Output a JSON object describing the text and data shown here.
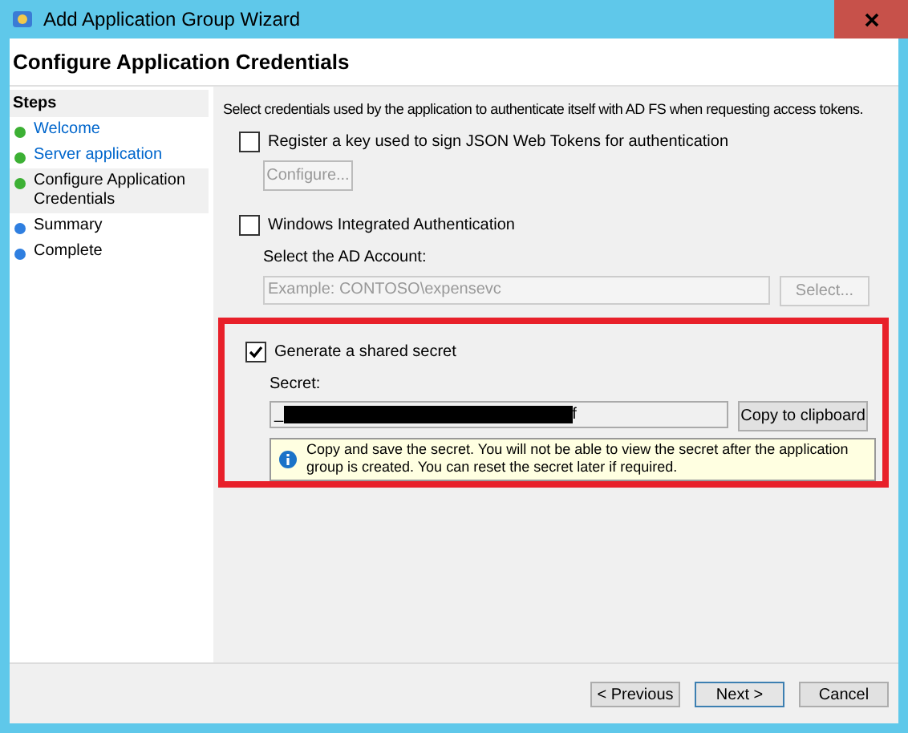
{
  "window": {
    "title": "Add Application Group Wizard"
  },
  "page_title": "Configure Application Credentials",
  "steps": {
    "heading": "Steps",
    "items": [
      {
        "label": "Welcome",
        "color": "#3cb034",
        "selected": false,
        "link": true
      },
      {
        "label": "Server application",
        "color": "#3cb034",
        "selected": false,
        "link": true
      },
      {
        "label": "Configure Application Credentials",
        "color": "#3cb034",
        "selected": true,
        "link": false
      },
      {
        "label": "Summary",
        "color": "#2f7fe0",
        "selected": false,
        "link": false
      },
      {
        "label": "Complete",
        "color": "#2f7fe0",
        "selected": false,
        "link": false
      }
    ]
  },
  "intro": "Select credentials used by the application to authenticate itself with AD FS when requesting access tokens.",
  "key_option": {
    "label": "Register a key used to sign JSON Web Tokens for authentication",
    "checked": false,
    "button": "Configure..."
  },
  "windows_auth": {
    "label": "Windows Integrated Authentication",
    "checked": false,
    "account_label": "Select the AD Account:",
    "placeholder": "Example: CONTOSO\\expensevc",
    "button": "Select..."
  },
  "shared_secret": {
    "label": "Generate a shared secret",
    "checked": true,
    "highlighted": true,
    "secret_label": "Secret:",
    "secret_start": "_",
    "redacted": true,
    "secret_end": "f",
    "copy_button": "Copy to clipboard",
    "info": "Copy and save the secret.  You will not be able to view the secret after the application group is created.  You can reset the secret later if required."
  },
  "buttons": [
    "< Previous",
    "Next >",
    "Cancel"
  ]
}
